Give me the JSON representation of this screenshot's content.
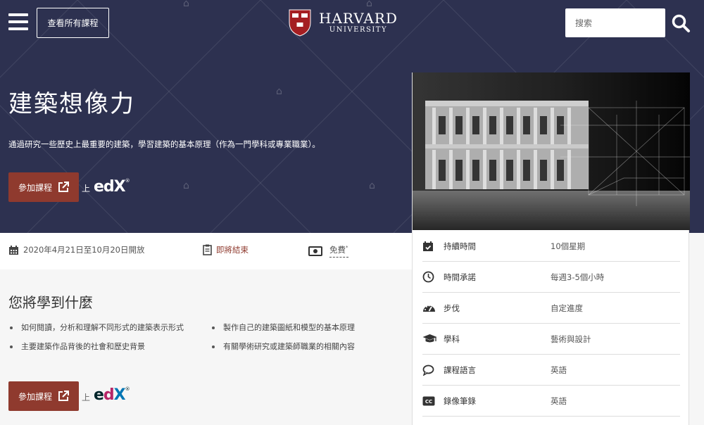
{
  "header": {
    "all_courses_label": "查看所有課程",
    "logo_title": "HARVARD",
    "logo_subtitle": "UNIVERSITY",
    "search_placeholder": "搜索"
  },
  "hero": {
    "title": "建築想像力",
    "description": "通過研究一些歷史上最重要的建築，學習建築的基本原理（作為一門學科或專業職業）。",
    "enroll_label": "參加課程",
    "on_label": "上",
    "provider": "edX"
  },
  "info_strip": {
    "dates": "2020年4月21日至10月20日開放",
    "status": "即將結束",
    "price": "免費",
    "price_mark": "*"
  },
  "learn": {
    "title": "您將學到什麼",
    "items": [
      "如何閱讀，分析和理解不同形式的建築表示形式",
      "製作自己的建築圖紙和模型的基本原理",
      "主要建築作品背後的社會和歷史背景",
      "有關學術研究或建築師職業的相關內容"
    ],
    "enroll_label": "參加課程",
    "on_label": "上",
    "provider": "edX"
  },
  "facts": [
    {
      "icon": "calendar-check-icon",
      "label": "持續時間",
      "value": "10個星期"
    },
    {
      "icon": "clock-icon",
      "label": "時間承諾",
      "value": "每週3-5個小時"
    },
    {
      "icon": "speedometer-icon",
      "label": "步伐",
      "value": "自定進度"
    },
    {
      "icon": "graduation-cap-icon",
      "label": "學科",
      "value": "藝術與設計"
    },
    {
      "icon": "speech-bubble-icon",
      "label": "課程語言",
      "value": "英語"
    },
    {
      "icon": "closed-caption-icon",
      "label": "錄像筆錄",
      "value": "英語"
    }
  ],
  "colors": {
    "hero_bg": "#2d3150",
    "accent": "#8f3a2e",
    "status_text": "#8f3a2e"
  }
}
